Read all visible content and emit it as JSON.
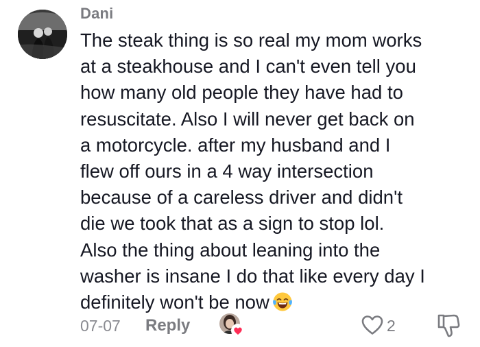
{
  "comment": {
    "username": "Dani",
    "text_lines": [
      "The steak thing is so real my mom works",
      "at a steakhouse and I can't even tell you",
      "how many old people they have had to",
      "resuscitate. Also I will never get back on",
      "a motorcycle. after my husband and I",
      "flew off ours in a 4 way intersection",
      "because of a careless driver and didn't",
      "die we took that as a sign to stop lol.",
      "Also the thing about leaning into the",
      "washer is insane I do that like every day I",
      "definitely won't be now"
    ],
    "emoji": "face-with-tears-of-joy",
    "date": "07-07",
    "reply_label": "Reply",
    "like_count": "2",
    "liked_by_creator": true
  },
  "icons": {
    "like": "heart-outline-icon",
    "dislike": "thumbs-down-icon",
    "creator_like_badge": "heart-icon"
  },
  "colors": {
    "text": "#161823",
    "secondary_text": "#7a7b80",
    "heart_badge": "#fe2c55",
    "emoji_face": "#ffc83d"
  }
}
